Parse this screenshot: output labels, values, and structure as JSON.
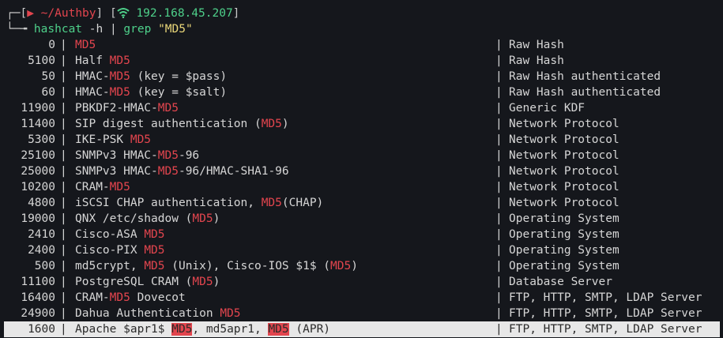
{
  "prompt": {
    "box_top_left": "┌─[",
    "triangle": "▶",
    "directory": "~/Authby",
    "box_close": "]",
    "box_dash": " - ",
    "box_ip_open": "[",
    "ip": "192.168.45.207",
    "box_ip_close": "]",
    "arrow": "└─╼ ",
    "command": "hashcat",
    "command_args": " -h | ",
    "grep": "grep",
    "grep_space": " ",
    "grep_string": "\"MD5\"",
    "wifi_icon": "wifi-icon"
  },
  "colors": {
    "background": "#15171c",
    "red": "#e2454e",
    "green": "#4ed08a",
    "yellow": "#e9d679",
    "text": "#d6d6d6",
    "selection": "#e7e7e7"
  },
  "rows": [
    {
      "num": "0",
      "parts": [
        {
          "t": "MD5",
          "hl": true
        }
      ],
      "cat": "Raw Hash"
    },
    {
      "num": "5100",
      "parts": [
        {
          "t": "Half "
        },
        {
          "t": "MD5",
          "hl": true
        }
      ],
      "cat": "Raw Hash"
    },
    {
      "num": "50",
      "parts": [
        {
          "t": "HMAC-"
        },
        {
          "t": "MD5",
          "hl": true
        },
        {
          "t": " (key = $pass)"
        }
      ],
      "cat": "Raw Hash authenticated"
    },
    {
      "num": "60",
      "parts": [
        {
          "t": "HMAC-"
        },
        {
          "t": "MD5",
          "hl": true
        },
        {
          "t": " (key = $salt)"
        }
      ],
      "cat": "Raw Hash authenticated"
    },
    {
      "num": "11900",
      "parts": [
        {
          "t": "PBKDF2-HMAC-"
        },
        {
          "t": "MD5",
          "hl": true
        }
      ],
      "cat": "Generic KDF"
    },
    {
      "num": "11400",
      "parts": [
        {
          "t": "SIP digest authentication ("
        },
        {
          "t": "MD5",
          "hl": true
        },
        {
          "t": ")"
        }
      ],
      "cat": "Network Protocol"
    },
    {
      "num": "5300",
      "parts": [
        {
          "t": "IKE-PSK "
        },
        {
          "t": "MD5",
          "hl": true
        }
      ],
      "cat": "Network Protocol"
    },
    {
      "num": "25100",
      "parts": [
        {
          "t": "SNMPv3 HMAC-"
        },
        {
          "t": "MD5",
          "hl": true
        },
        {
          "t": "-96"
        }
      ],
      "cat": "Network Protocol"
    },
    {
      "num": "25000",
      "parts": [
        {
          "t": "SNMPv3 HMAC-"
        },
        {
          "t": "MD5",
          "hl": true
        },
        {
          "t": "-96/HMAC-SHA1-96"
        }
      ],
      "cat": "Network Protocol"
    },
    {
      "num": "10200",
      "parts": [
        {
          "t": "CRAM-"
        },
        {
          "t": "MD5",
          "hl": true
        }
      ],
      "cat": "Network Protocol"
    },
    {
      "num": "4800",
      "parts": [
        {
          "t": "iSCSI CHAP authentication, "
        },
        {
          "t": "MD5",
          "hl": true
        },
        {
          "t": "(CHAP)"
        }
      ],
      "cat": "Network Protocol"
    },
    {
      "num": "19000",
      "parts": [
        {
          "t": "QNX /etc/shadow ("
        },
        {
          "t": "MD5",
          "hl": true
        },
        {
          "t": ")"
        }
      ],
      "cat": "Operating System"
    },
    {
      "num": "2410",
      "parts": [
        {
          "t": "Cisco-ASA "
        },
        {
          "t": "MD5",
          "hl": true
        }
      ],
      "cat": "Operating System"
    },
    {
      "num": "2400",
      "parts": [
        {
          "t": "Cisco-PIX "
        },
        {
          "t": "MD5",
          "hl": true
        }
      ],
      "cat": "Operating System"
    },
    {
      "num": "500",
      "parts": [
        {
          "t": "md5crypt, "
        },
        {
          "t": "MD5",
          "hl": true
        },
        {
          "t": " (Unix), Cisco-IOS $1$ ("
        },
        {
          "t": "MD5",
          "hl": true
        },
        {
          "t": ")"
        }
      ],
      "cat": "Operating System"
    },
    {
      "num": "11100",
      "parts": [
        {
          "t": "PostgreSQL CRAM ("
        },
        {
          "t": "MD5",
          "hl": true
        },
        {
          "t": ")"
        }
      ],
      "cat": "Database Server"
    },
    {
      "num": "16400",
      "parts": [
        {
          "t": "CRAM-"
        },
        {
          "t": "MD5",
          "hl": true
        },
        {
          "t": " Dovecot"
        }
      ],
      "cat": "FTP, HTTP, SMTP, LDAP Server"
    },
    {
      "num": "24900",
      "parts": [
        {
          "t": "Dahua Authentication "
        },
        {
          "t": "MD5",
          "hl": true
        }
      ],
      "cat": "FTP, HTTP, SMTP, LDAP Server"
    },
    {
      "num": "1600",
      "parts": [
        {
          "t": "Apache $apr1$ "
        },
        {
          "t": "MD5",
          "hl": true
        },
        {
          "t": ", md5apr1, "
        },
        {
          "t": "MD5",
          "hl": true
        },
        {
          "t": " (APR)"
        }
      ],
      "cat": "FTP, HTTP, SMTP, LDAP Server",
      "selected": true
    }
  ],
  "separator": "|"
}
